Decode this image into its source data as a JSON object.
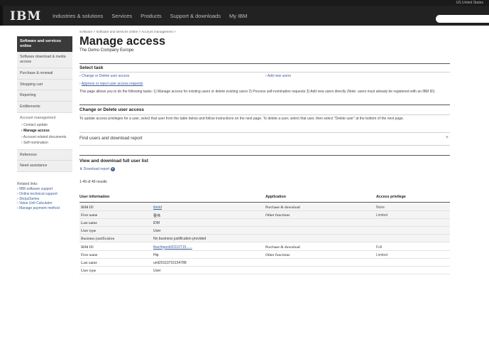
{
  "masthead": {
    "country": "US  United States",
    "logo": "IBM",
    "nav": [
      "Industries & solutions",
      "Services",
      "Products",
      "Support & downloads",
      "My IBM"
    ]
  },
  "sidebar": {
    "header": "Software and services online",
    "items": [
      "Software download & media access",
      "Purchase & renewal",
      "Shopping cart",
      "Reporting",
      "Entitlements"
    ],
    "account_management": {
      "label": "Account management",
      "subs": [
        "Contact update",
        "Manage access",
        "Account related documents",
        "Self-nomination"
      ]
    },
    "items_after": [
      "Reference",
      "Need assistance"
    ],
    "related": {
      "heading": "Related links",
      "links": [
        "IBM software support",
        "Online technical support",
        "ShopzSeries",
        "Value Unit Calculator",
        "Manage payment method"
      ]
    }
  },
  "main": {
    "breadcrumb": "Software  >  Software and services online  >  Account management  >",
    "title": "Manage access",
    "subtitle": "The Demo Company Europe",
    "select_task": {
      "heading": "Select task",
      "links": [
        "Change or Delete user access",
        "Add new users",
        "Approve or reject user access requests"
      ],
      "description": "This page allows you to do the following tasks: 1) Manage access for existing users or delete existing users 2) Process self-nomination requests 3) Add new users directly (Note: users must already be registered with an IBM ID)."
    },
    "change_delete": {
      "heading": "Change or Delete user access",
      "description": "To update access privileges for a user, select that user from the table below and follow instructions on the next page. To delete a user, select that user, then select \"Delete user\" at the bottom of the next page."
    },
    "find_users": {
      "label": "Find users and download report",
      "toggle": "+"
    },
    "download": {
      "heading": "View and download full user list",
      "link": "Download report",
      "help_icon": "?"
    },
    "results": "1-49 of 49 results",
    "table": {
      "headers": [
        "User information",
        "Application",
        "Access privilege"
      ],
      "users": [
        {
          "rows": [
            {
              "label": "IBM ID",
              "value": "ibmid",
              "value_link": true,
              "app": "Purchase & download",
              "priv": "None"
            },
            {
              "label": "First name",
              "value": "曹伟",
              "app": "Other functions",
              "priv": "Limited"
            },
            {
              "label": "Last name",
              "value": "iDM"
            },
            {
              "label": "User type",
              "value": "User"
            },
            {
              "label": "Business justification",
              "value": "No business justification provided"
            }
          ]
        },
        {
          "rows": [
            {
              "label": "IBM ID",
              "value": "tbachtpunit20110715......",
              "value_link": true,
              "app": "Purchase & download",
              "priv": "Full"
            },
            {
              "label": "First name",
              "value": "Hip",
              "app": "Other functions",
              "priv": "Limited"
            },
            {
              "label": "Last name",
              "value": "unit20110715154788"
            },
            {
              "label": "User type",
              "value": "User"
            }
          ]
        }
      ]
    }
  }
}
